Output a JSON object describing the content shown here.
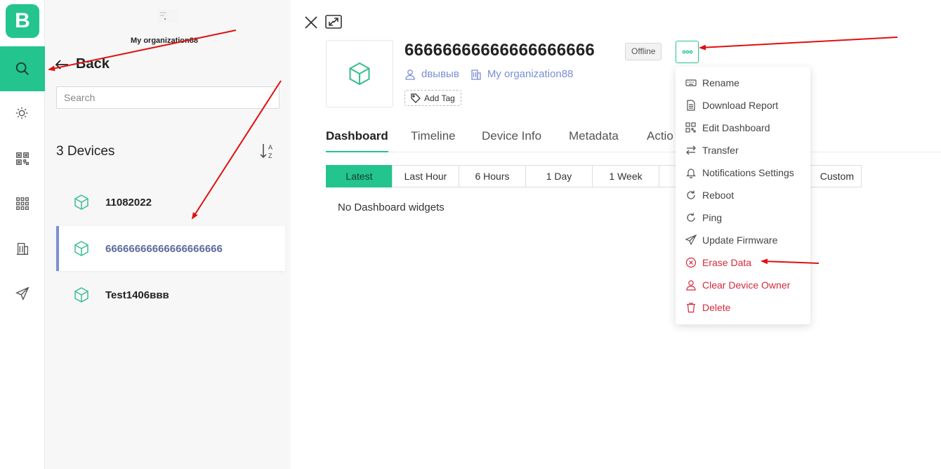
{
  "app": {
    "logo_letter": "B"
  },
  "rail": {
    "items": [
      "search-icon",
      "sun-icon",
      "qr-code-icon",
      "grid-icon",
      "building-icon",
      "send-icon"
    ],
    "active": "search-icon"
  },
  "panel": {
    "org_name": "My organization88",
    "back_label": "Back",
    "search": {
      "placeholder": "Search",
      "value": ""
    },
    "device_count_label": "3 Devices",
    "devices": [
      {
        "name": "11082022",
        "selected": false
      },
      {
        "name": "66666666666666666666",
        "selected": true
      },
      {
        "name": "Test1406ввв",
        "selected": false
      }
    ]
  },
  "detail": {
    "title": "66666666666666666666",
    "status": "Offline",
    "owner": "dвывыв",
    "organization": "My organization88",
    "add_tag_label": "Add Tag",
    "tabs": [
      {
        "label": "Dashboard",
        "active": true
      },
      {
        "label": "Timeline",
        "active": false
      },
      {
        "label": "Device Info",
        "active": false
      },
      {
        "label": "Metadata",
        "active": false
      },
      {
        "label": "Actio",
        "active": false
      }
    ],
    "ranges": [
      {
        "label": "Latest",
        "active": true
      },
      {
        "label": "Last Hour",
        "active": false
      },
      {
        "label": "6 Hours",
        "active": false
      },
      {
        "label": "1 Day",
        "active": false
      },
      {
        "label": "1 Week",
        "active": false
      },
      {
        "label": "Custom",
        "active": false
      }
    ],
    "empty_message": "No Dashboard widgets"
  },
  "menu": {
    "items": [
      {
        "label": "Rename",
        "icon": "keyboard-icon",
        "danger": false
      },
      {
        "label": "Download Report",
        "icon": "report-icon",
        "danger": false
      },
      {
        "label": "Edit Dashboard",
        "icon": "dashboard-icon",
        "danger": false
      },
      {
        "label": "Transfer",
        "icon": "transfer-icon",
        "danger": false
      },
      {
        "label": "Notifications Settings",
        "icon": "bell-icon",
        "danger": false
      },
      {
        "label": "Reboot",
        "icon": "reboot-icon",
        "danger": false
      },
      {
        "label": "Ping",
        "icon": "ping-icon",
        "danger": false
      },
      {
        "label": "Update Firmware",
        "icon": "send-icon",
        "danger": false
      },
      {
        "label": "Erase Data",
        "icon": "erase-icon",
        "danger": true
      },
      {
        "label": "Clear Device Owner",
        "icon": "user-icon",
        "danger": true
      },
      {
        "label": "Delete",
        "icon": "trash-icon",
        "danger": true
      }
    ]
  },
  "colors": {
    "accent": "#23c48e",
    "link": "#7b8fd4",
    "danger": "#d42a3a",
    "annotation": "#e01010"
  }
}
